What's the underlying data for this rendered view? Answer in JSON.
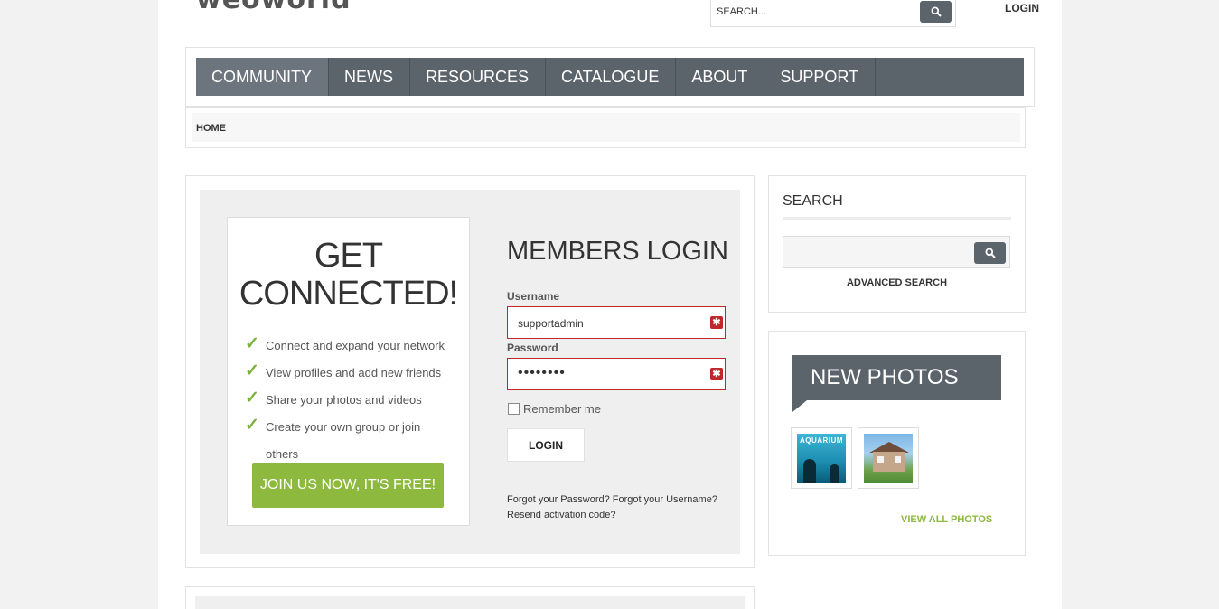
{
  "header": {
    "logo_text": "weoworld",
    "search_placeholder": "SEARCH...",
    "login_link": "LOGIN"
  },
  "nav": {
    "items": [
      {
        "label": "COMMUNITY",
        "active": true
      },
      {
        "label": "NEWS",
        "active": false
      },
      {
        "label": "RESOURCES",
        "active": false
      },
      {
        "label": "CATALOGUE",
        "active": false
      },
      {
        "label": "ABOUT",
        "active": false
      },
      {
        "label": "SUPPORT",
        "active": false
      }
    ]
  },
  "breadcrumb": {
    "home": "HOME"
  },
  "connect": {
    "title_line1": "GET",
    "title_line2": "CONNECTED!",
    "features": [
      "Connect and expand your network",
      "View profiles and add new friends",
      "Share your photos and videos",
      "Create your own group or join",
      "others"
    ],
    "join_button": "JOIN US NOW, IT'S FREE!"
  },
  "login": {
    "title": "MEMBERS LOGIN",
    "username_label": "Username",
    "username_value": "supportadmin",
    "password_label": "Password",
    "password_value": "••••••••",
    "remember_label": "Remember me",
    "login_button": "LOGIN",
    "forgot_password": "Forgot your Password?",
    "forgot_username": "Forgot your Username?",
    "resend_activation": "Resend activation code?"
  },
  "sidebar": {
    "search_title": "SEARCH",
    "advanced_search": "ADVANCED SEARCH",
    "photos_title": "NEW PHOTOS",
    "photo1_label": "AQUARIUM",
    "view_all": "VIEW ALL PHOTOS"
  },
  "colors": {
    "nav_bg": "#5b636b",
    "accent_green": "#8cb93e",
    "required_red": "#c0272d"
  }
}
